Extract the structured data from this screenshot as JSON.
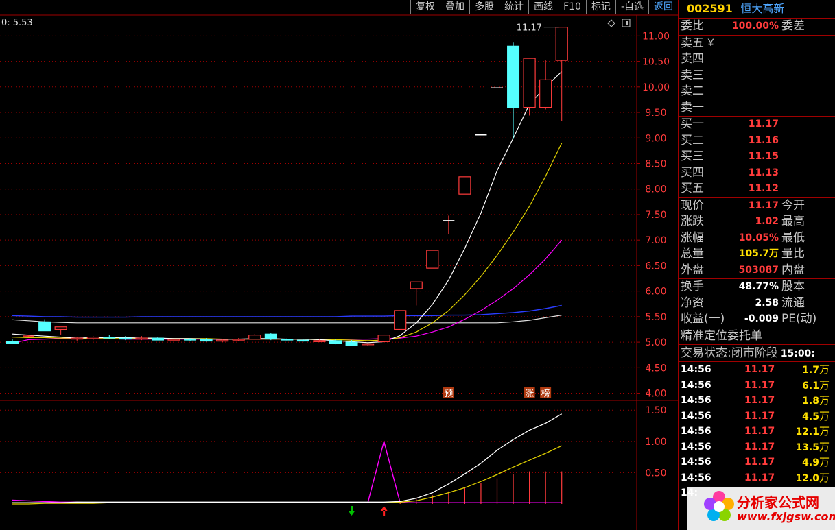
{
  "toolbar": {
    "buttons": [
      "复权",
      "叠加",
      "多股",
      "统计",
      "画线",
      "F10",
      "标记",
      "-自选",
      "返回"
    ]
  },
  "chart_header": {
    "text": "0: 5.53"
  },
  "chart_icons": {
    "diamond": "diamond-icon",
    "window": "window-toggle-icon"
  },
  "price_annotation": "11.17",
  "markers": {
    "pre": "预",
    "limit": "涨",
    "board": "榜"
  },
  "colors": {
    "up": "#ff3b3b",
    "down": "#55ffff",
    "ma5": "#ffffff",
    "ma10": "#e0d000",
    "ma20": "#ff00ff",
    "ma60": "#2b3dff",
    "ma_long": "#e0e0e0",
    "grid": "#a00000"
  },
  "chart_data": {
    "type": "candlestick",
    "y_main_ticks": [
      "11.00",
      "10.50",
      "10.00",
      "9.50",
      "9.00",
      "8.50",
      "8.00",
      "7.50",
      "7.00",
      "6.50",
      "6.00",
      "5.50",
      "5.00",
      "4.50",
      "4.00"
    ],
    "y_main_range": [
      3.9,
      11.3
    ],
    "y_sub_ticks": [
      "1.50",
      "1.00",
      "0.50"
    ],
    "y_sub_range": [
      0,
      1.7
    ],
    "candles": [
      {
        "o": 5.02,
        "h": 5.06,
        "l": 4.98,
        "c": 4.97
      },
      {
        "o": 5.12,
        "h": 5.14,
        "l": 5.1,
        "c": 5.12
      },
      {
        "o": 5.4,
        "h": 5.45,
        "l": 5.3,
        "c": 5.22
      },
      {
        "o": 5.25,
        "h": 5.3,
        "l": 5.15,
        "c": 5.3
      },
      {
        "o": 5.06,
        "h": 5.1,
        "l": 5.03,
        "c": 5.08
      },
      {
        "o": 5.07,
        "h": 5.12,
        "l": 5.04,
        "c": 5.1
      },
      {
        "o": 5.1,
        "h": 5.14,
        "l": 5.06,
        "c": 5.08
      },
      {
        "o": 5.08,
        "h": 5.12,
        "l": 5.04,
        "c": 5.06
      },
      {
        "o": 5.06,
        "h": 5.12,
        "l": 5.04,
        "c": 5.08
      },
      {
        "o": 5.08,
        "h": 5.1,
        "l": 5.04,
        "c": 5.04
      },
      {
        "o": 5.04,
        "h": 5.08,
        "l": 5.01,
        "c": 5.06
      },
      {
        "o": 5.06,
        "h": 5.08,
        "l": 5.02,
        "c": 5.05
      },
      {
        "o": 5.05,
        "h": 5.08,
        "l": 5.01,
        "c": 5.02
      },
      {
        "o": 5.02,
        "h": 5.06,
        "l": 5.0,
        "c": 5.04
      },
      {
        "o": 5.04,
        "h": 5.08,
        "l": 5.02,
        "c": 5.06
      },
      {
        "o": 5.06,
        "h": 5.16,
        "l": 5.05,
        "c": 5.14
      },
      {
        "o": 5.16,
        "h": 5.18,
        "l": 5.04,
        "c": 5.06
      },
      {
        "o": 5.06,
        "h": 5.08,
        "l": 5.02,
        "c": 5.04
      },
      {
        "o": 5.04,
        "h": 5.06,
        "l": 5.01,
        "c": 5.02
      },
      {
        "o": 5.02,
        "h": 5.05,
        "l": 5.0,
        "c": 5.03
      },
      {
        "o": 5.03,
        "h": 5.06,
        "l": 4.96,
        "c": 4.98
      },
      {
        "o": 5.0,
        "h": 5.04,
        "l": 4.93,
        "c": 4.94
      },
      {
        "o": 4.95,
        "h": 4.98,
        "l": 4.93,
        "c": 4.97
      },
      {
        "o": 5.01,
        "h": 5.15,
        "l": 5.0,
        "c": 5.14
      },
      {
        "o": 5.25,
        "h": 5.62,
        "l": 5.25,
        "c": 5.62
      },
      {
        "o": 6.05,
        "h": 6.18,
        "l": 5.72,
        "c": 6.18
      },
      {
        "o": 6.45,
        "h": 6.8,
        "l": 6.45,
        "c": 6.8
      },
      {
        "o": 7.38,
        "h": 7.48,
        "l": 7.12,
        "c": 7.38
      },
      {
        "o": 7.9,
        "h": 8.24,
        "l": 7.9,
        "c": 8.24
      },
      {
        "o": 9.06,
        "h": 9.06,
        "l": 9.06,
        "c": 9.06
      },
      {
        "o": 9.98,
        "h": 9.98,
        "l": 9.34,
        "c": 9.98
      },
      {
        "o": 10.8,
        "h": 10.88,
        "l": 8.98,
        "c": 9.6
      },
      {
        "o": 9.6,
        "h": 10.56,
        "l": 9.44,
        "c": 10.56
      },
      {
        "o": 9.6,
        "h": 10.52,
        "l": 9.56,
        "c": 10.14
      },
      {
        "o": 10.52,
        "h": 11.17,
        "l": 9.33,
        "c": 11.17
      }
    ],
    "ma5": [
      5.16,
      5.14,
      5.12,
      5.1,
      5.08,
      5.09,
      5.09,
      5.09,
      5.08,
      5.08,
      5.07,
      5.07,
      5.06,
      5.06,
      5.06,
      5.07,
      5.07,
      5.06,
      5.06,
      5.05,
      5.03,
      5.01,
      4.99,
      5.01,
      5.13,
      5.38,
      5.74,
      6.22,
      6.84,
      7.53,
      8.36,
      9.0,
      9.66,
      10.0,
      10.3
    ],
    "ma10": [
      5.1,
      5.09,
      5.09,
      5.08,
      5.08,
      5.07,
      5.07,
      5.07,
      5.07,
      5.07,
      5.07,
      5.07,
      5.07,
      5.06,
      5.06,
      5.06,
      5.06,
      5.06,
      5.06,
      5.05,
      5.05,
      5.04,
      5.03,
      5.04,
      5.09,
      5.2,
      5.38,
      5.62,
      5.93,
      6.29,
      6.7,
      7.16,
      7.66,
      8.25,
      8.9
    ],
    "ma20": [
      4.98,
      5.05,
      5.06,
      5.07,
      5.07,
      5.07,
      5.07,
      5.06,
      5.06,
      5.06,
      5.06,
      5.06,
      5.06,
      5.06,
      5.06,
      5.06,
      5.06,
      5.06,
      5.06,
      5.06,
      5.06,
      5.06,
      5.06,
      5.07,
      5.08,
      5.12,
      5.2,
      5.3,
      5.45,
      5.62,
      5.82,
      6.05,
      6.32,
      6.63,
      7.0
    ],
    "ma60": [
      5.52,
      5.51,
      5.5,
      5.5,
      5.49,
      5.49,
      5.49,
      5.49,
      5.5,
      5.5,
      5.5,
      5.5,
      5.5,
      5.5,
      5.5,
      5.5,
      5.5,
      5.5,
      5.5,
      5.5,
      5.5,
      5.51,
      5.51,
      5.51,
      5.52,
      5.52,
      5.52,
      5.53,
      5.53,
      5.54,
      5.56,
      5.58,
      5.61,
      5.66,
      5.72
    ],
    "ma_long": [
      5.44,
      5.42,
      5.4,
      5.39,
      5.38,
      5.38,
      5.38,
      5.38,
      5.38,
      5.38,
      5.38,
      5.38,
      5.38,
      5.38,
      5.38,
      5.38,
      5.38,
      5.38,
      5.38,
      5.38,
      5.38,
      5.38,
      5.38,
      5.38,
      5.38,
      5.38,
      5.38,
      5.38,
      5.38,
      5.38,
      5.38,
      5.4,
      5.43,
      5.48,
      5.53
    ],
    "sub_white": [
      0.02,
      0.02,
      0.02,
      0.02,
      0.03,
      0.03,
      0.03,
      0.03,
      0.03,
      0.03,
      0.03,
      0.03,
      0.03,
      0.03,
      0.03,
      0.03,
      0.03,
      0.03,
      0.03,
      0.03,
      0.03,
      0.03,
      0.03,
      0.03,
      0.04,
      0.09,
      0.18,
      0.32,
      0.48,
      0.65,
      0.86,
      1.03,
      1.18,
      1.29,
      1.44
    ],
    "sub_yellow": [
      0.0,
      0.0,
      0.01,
      0.01,
      0.01,
      0.01,
      0.02,
      0.02,
      0.02,
      0.02,
      0.02,
      0.02,
      0.02,
      0.02,
      0.02,
      0.02,
      0.02,
      0.02,
      0.02,
      0.02,
      0.02,
      0.02,
      0.02,
      0.02,
      0.03,
      0.05,
      0.11,
      0.18,
      0.26,
      0.36,
      0.47,
      0.59,
      0.7,
      0.81,
      0.93
    ],
    "sub_magenta": [
      0.06,
      0.05,
      0.04,
      0.03,
      0.03,
      0.02,
      0.02,
      0.02,
      0.02,
      0.02,
      0.02,
      0.02,
      0.02,
      0.02,
      0.02,
      0.02,
      0.02,
      0.02,
      0.02,
      0.02,
      0.02,
      0.02,
      0.02,
      1.0,
      0.02,
      0.02,
      0.02,
      0.02,
      0.02,
      0.02,
      0.02,
      0.02,
      0.02,
      0.02,
      0.02
    ],
    "sub_bars": [
      0,
      0,
      0,
      0,
      0,
      0,
      0,
      0,
      0,
      0,
      0,
      0,
      0,
      0,
      0,
      0,
      0,
      0,
      0,
      0,
      0,
      0,
      0,
      0,
      0.02,
      0.08,
      0.14,
      0.2,
      0.27,
      0.34,
      0.41,
      0.48,
      0.52,
      0.52,
      0.52
    ],
    "signals": [
      {
        "index": 21,
        "dir": "down"
      },
      {
        "index": 23,
        "dir": "up"
      }
    ]
  },
  "panel": {
    "code": "002591",
    "name": "恒大高新",
    "weibi": {
      "label": "委比",
      "value": "100.00%",
      "label2": "委差"
    },
    "asks": [
      {
        "label": "卖五",
        "extra": "￥"
      },
      {
        "label": "卖四"
      },
      {
        "label": "卖三"
      },
      {
        "label": "卖二"
      },
      {
        "label": "卖一"
      }
    ],
    "bids": [
      {
        "label": "买一",
        "price": "11.17"
      },
      {
        "label": "买二",
        "price": "11.16"
      },
      {
        "label": "买三",
        "price": "11.15"
      },
      {
        "label": "买四",
        "price": "11.13"
      },
      {
        "label": "买五",
        "price": "11.12"
      }
    ],
    "quote": [
      {
        "label": "现价",
        "value": "11.17",
        "label2": "今开",
        "color": "red"
      },
      {
        "label": "涨跌",
        "value": "1.02",
        "label2": "最高",
        "color": "red"
      },
      {
        "label": "涨幅",
        "value": "10.05%",
        "label2": "最低",
        "color": "red"
      },
      {
        "label": "总量",
        "value": "105.7万",
        "label2": "量比",
        "color": "yellow"
      },
      {
        "label": "外盘",
        "value": "503087",
        "label2": "内盘",
        "color": "red"
      }
    ],
    "stats": [
      {
        "label": "换手",
        "value": "48.77%",
        "label2": "股本",
        "color": "white"
      },
      {
        "label": "净资",
        "value": "2.58",
        "label2": "流通",
        "color": "white"
      },
      {
        "label": "收益(一)",
        "value": "-0.009",
        "label2": "PE(动)",
        "color": "white"
      }
    ],
    "order_title": "精准定位委托单",
    "status_label": "交易状态:",
    "status_value": "闭市阶段",
    "status_time": "15:00:",
    "ticks": [
      {
        "time": "14:56",
        "price": "11.17",
        "vol": "1.7",
        "unit": "万"
      },
      {
        "time": "14:56",
        "price": "11.17",
        "vol": "6.1",
        "unit": "万"
      },
      {
        "time": "14:56",
        "price": "11.17",
        "vol": "1.8",
        "unit": "万"
      },
      {
        "time": "14:56",
        "price": "11.17",
        "vol": "4.5",
        "unit": "万"
      },
      {
        "time": "14:56",
        "price": "11.17",
        "vol": "12.1",
        "unit": "万"
      },
      {
        "time": "14:56",
        "price": "11.17",
        "vol": "13.5",
        "unit": "万"
      },
      {
        "time": "14:56",
        "price": "11.17",
        "vol": "4.9",
        "unit": "万"
      },
      {
        "time": "14:56",
        "price": "11.17",
        "vol": "12.0",
        "unit": "万"
      },
      {
        "time": "14:",
        "price": "",
        "vol": "",
        "unit": ""
      }
    ]
  },
  "watermark": {
    "text": "分析家公式网",
    "url": "www.fxjgsw.com"
  }
}
